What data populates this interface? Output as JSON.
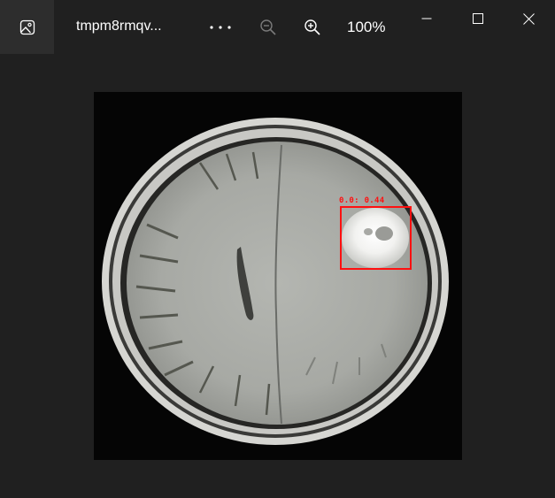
{
  "window": {
    "file_name": "tmpm8rmqv...",
    "zoom_level": "100%"
  },
  "icons": {
    "app": "photos-app-icon",
    "more": "more-options-icon",
    "zoom_out": "zoom-out-icon",
    "zoom_in": "zoom-in-icon",
    "minimize": "minimize-icon",
    "maximize": "maximize-icon",
    "close": "close-icon"
  },
  "detection": {
    "label": "0.0: 0.44",
    "box_color": "#ff1010"
  },
  "colors": {
    "titlebar_bg": "#202020",
    "app_button_bg": "#2d2d2d",
    "text": "#ffffff",
    "disabled_icon": "#7a7a7a"
  }
}
